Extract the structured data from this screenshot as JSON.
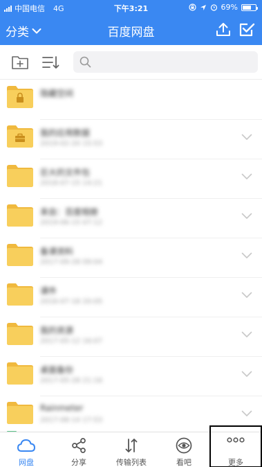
{
  "status_bar": {
    "carrier": "中国电信",
    "network": "4G",
    "time": "下午3:21",
    "battery_percent": "69%",
    "battery_level": 0.69
  },
  "header": {
    "category_label": "分类",
    "title": "百度网盘",
    "upload_icon": "upload-icon",
    "select_icon": "checkbox-icon"
  },
  "toolbar": {
    "new_folder_icon": "new-folder-icon",
    "sort_icon": "sort-icon",
    "search_icon": "search-icon",
    "search_placeholder": ""
  },
  "files": [
    {
      "name": "隐藏空间",
      "meta": "",
      "icon": "lock-folder-icon",
      "chevron": false
    },
    {
      "name": "我的应用数据",
      "meta": "2019-02-20 15:53",
      "icon": "briefcase-folder-icon",
      "chevron": true
    },
    {
      "name": "巨大的文件包",
      "meta": "2018-07-15 14:21",
      "icon": "folder-icon",
      "chevron": true
    },
    {
      "name": "来自：百度相册",
      "meta": "2019-06-15 07:12",
      "icon": "folder-icon",
      "chevron": true
    },
    {
      "name": "备课资料",
      "meta": "2017-09-28 09:04",
      "icon": "folder-icon",
      "chevron": true
    },
    {
      "name": "课件",
      "meta": "2016-07-18 20:05",
      "icon": "folder-icon",
      "chevron": true
    },
    {
      "name": "我的资源",
      "meta": "2017-05-12 16:07",
      "icon": "folder-icon",
      "chevron": true
    },
    {
      "name": "桌面备份",
      "meta": "2017-05-28 21:16",
      "icon": "folder-icon",
      "chevron": true
    },
    {
      "name": "Rainmeter",
      "meta": "2017-08-14 17:53",
      "icon": "folder-icon",
      "chevron": true
    }
  ],
  "tabs": [
    {
      "label": "网盘",
      "icon": "cloud-icon",
      "active": true
    },
    {
      "label": "分享",
      "icon": "share-icon",
      "active": false
    },
    {
      "label": "传输列表",
      "icon": "transfer-icon",
      "active": false
    },
    {
      "label": "看吧",
      "icon": "eye-icon",
      "active": false
    },
    {
      "label": "更多",
      "icon": "more-icon",
      "active": false
    }
  ],
  "colors": {
    "brand_blue": "#3a88f2",
    "folder_yellow": "#f8cf5c",
    "folder_tab": "#f0b93e",
    "highlight_box": "#000000"
  }
}
